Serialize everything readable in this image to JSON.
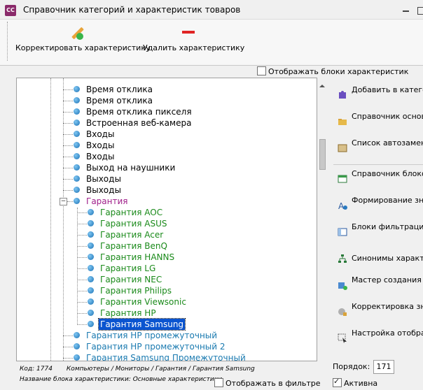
{
  "window": {
    "title": "Справочник категорий и характеристик товаров",
    "icon_text": "CC"
  },
  "toolbar": {
    "edit_label": "Корректировать характеристику",
    "delete_label": "Удалить характеристику",
    "edit_icon": "pencil-check-icon",
    "delete_icon": "minus-icon",
    "delete_color": "#e02424"
  },
  "show_blocks": {
    "label": "Отображать блоки характеристик",
    "checked": false
  },
  "tree": {
    "items": [
      "Время отклика",
      "Время отклика",
      "Время отклика пикселя",
      "Встроенная веб-камера",
      "Входы",
      "Входы",
      "Входы",
      "Выход на наушники",
      "Выходы",
      "Выходы"
    ],
    "group_label": "Гарантия",
    "group_expander": "−",
    "children": [
      "Гарантия AOC",
      "Гарантия ASUS",
      "Гарантия Acer",
      "Гарантия BenQ",
      "Гарантия HANNS",
      "Гарантия LG",
      "Гарантия NEC",
      "Гарантия Philips",
      "Гарантия Viewsonic",
      "Гарантия HP"
    ],
    "selected": "Гарантия Samsung",
    "after": [
      "Гарантия HP промежуточный",
      "Гарантия HP промежуточный 2",
      "Гарантия Samsung Промежуточный"
    ]
  },
  "actions": [
    "Добавить в категорию основные характеристики",
    "Справочник основных характеристик",
    "Список автозамены характеристик",
    "Справочник блоков характеристик",
    "Формирование значения поле описание",
    "Блоки фильтрации характеристики (\"вид\")",
    "Синонимы характеристик",
    "Мастер создания новых характеристик",
    "Корректировка значений характеристик в описании",
    "Настройка отображения фильтрации товаров"
  ],
  "status": {
    "code": "Код: 1774",
    "path": "Компьютеры / Мониторы / Гарантия / Гарантия Samsung",
    "block_name": "Название блока характеристики: Основные характеристики"
  },
  "show_in_filter": {
    "label": "Отображать в фильтре",
    "checked": false
  },
  "order": {
    "label": "Порядок:",
    "value": "171"
  },
  "active": {
    "label": "Активна",
    "checked": true
  },
  "colors": {
    "group": "#a0208a",
    "child": "#1a8a1a",
    "after": "#1a7ab0",
    "selection": "#0a54d0"
  }
}
